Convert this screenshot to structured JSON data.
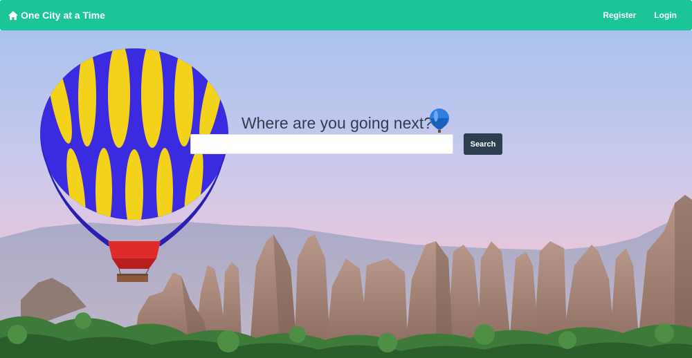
{
  "navbar": {
    "brand_title": "One City at a Time",
    "brand_icon": "home-icon",
    "register_label": "Register",
    "login_label": "Login",
    "background_color": "#1cc597"
  },
  "hero": {
    "headline": "Where are you going next?",
    "headline_icon": "hot-air-balloon-icon",
    "search": {
      "value": "",
      "placeholder": ""
    },
    "search_button_label": "Search",
    "button_color": "#2d3e50"
  }
}
